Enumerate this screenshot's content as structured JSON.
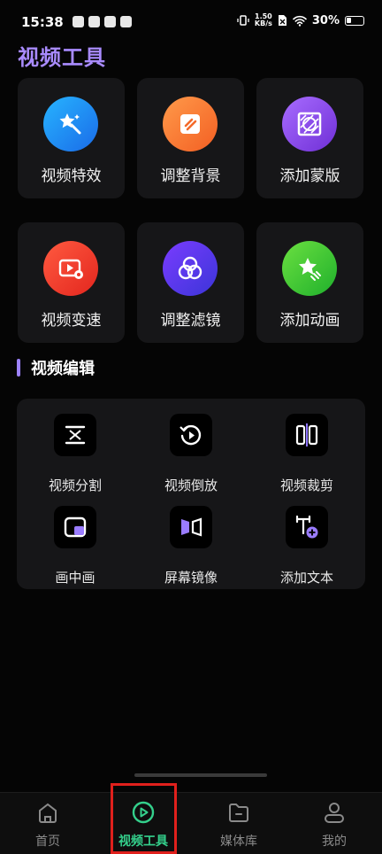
{
  "status_bar": {
    "time": "15:38",
    "net_speed_top": "1.50",
    "net_speed_bottom": "KB/s",
    "battery_pct": "30%"
  },
  "page_title": "视频工具",
  "tools": [
    {
      "label": "视频特效",
      "icon": "magic-wand-star-icon",
      "color": "#1f8ff0"
    },
    {
      "label": "调整背景",
      "icon": "background-icon",
      "color": "#fb7a32"
    },
    {
      "label": "添加蒙版",
      "icon": "mask-icon",
      "color": "#8c4ee8"
    },
    {
      "label": "视频变速",
      "icon": "video-speed-icon",
      "color": "#f2402f"
    },
    {
      "label": "调整滤镜",
      "icon": "filter-circles-icon",
      "color": "#5b35e0"
    },
    {
      "label": "添加动画",
      "icon": "animation-star-icon",
      "color": "#3ec634"
    }
  ],
  "section_title": "视频编辑",
  "edit_tools": [
    {
      "label": "视频分割",
      "icon": "split-icon"
    },
    {
      "label": "视频倒放",
      "icon": "reverse-icon"
    },
    {
      "label": "视频裁剪",
      "icon": "crop-icon"
    },
    {
      "label": "画中画",
      "icon": "pip-icon"
    },
    {
      "label": "屏幕镜像",
      "icon": "mirror-icon"
    },
    {
      "label": "添加文本",
      "icon": "add-text-icon"
    }
  ],
  "nav": [
    {
      "label": "首页",
      "icon": "home-icon",
      "active": false
    },
    {
      "label": "视频工具",
      "icon": "play-circle-icon",
      "active": true
    },
    {
      "label": "媒体库",
      "icon": "folder-icon",
      "active": false
    },
    {
      "label": "我的",
      "icon": "user-icon",
      "active": false
    }
  ],
  "colors": {
    "accent": "#34d08c",
    "title": "#a98bff",
    "highlight_border": "#e0201c"
  }
}
